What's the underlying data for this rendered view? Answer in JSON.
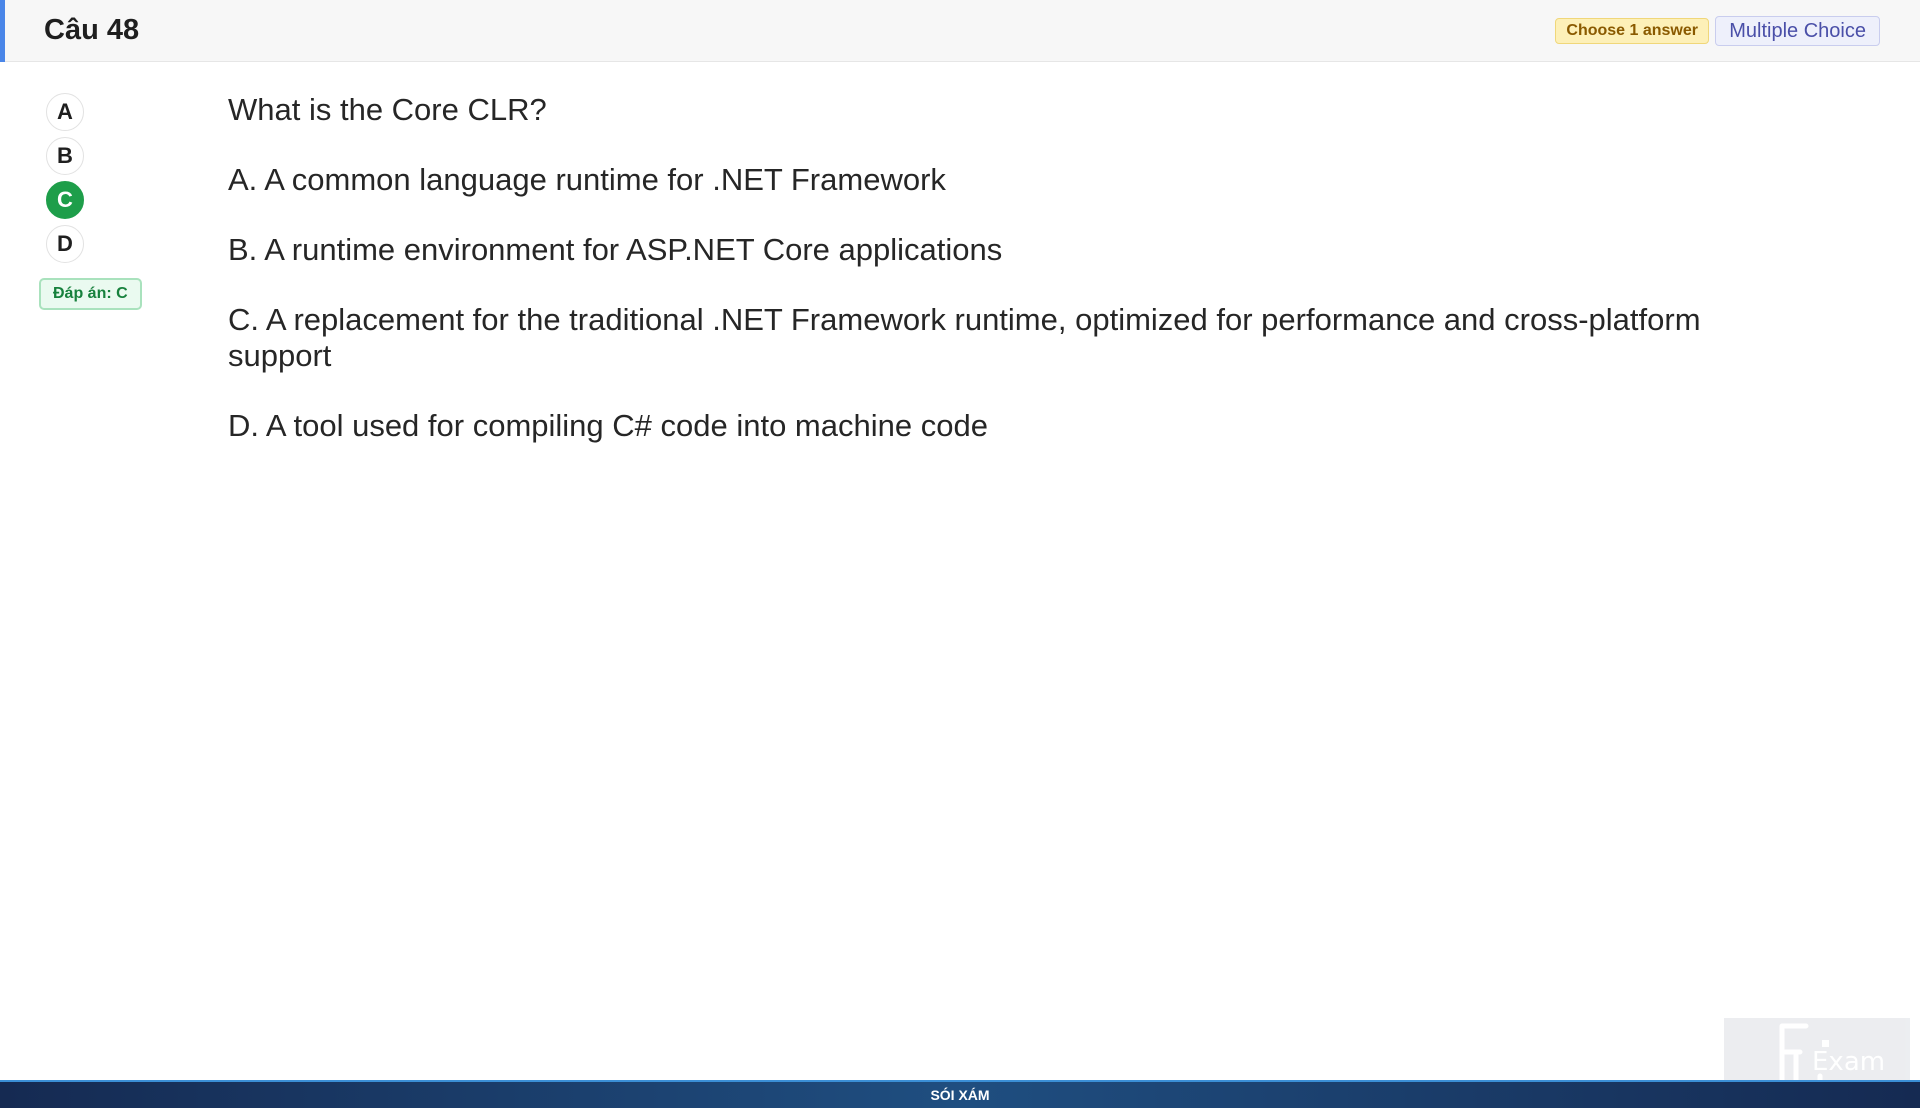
{
  "header": {
    "question_number": "Câu 48",
    "choose_badge": "Choose 1 answer",
    "type_badge": "Multiple Choice"
  },
  "options": {
    "letters": [
      "A",
      "B",
      "C",
      "D"
    ],
    "selected": "C"
  },
  "answer_badge": "Đáp án: C",
  "question": {
    "text": "What is the Core CLR?",
    "choices": [
      "A.  A common language runtime for .NET Framework",
      "B.  A runtime environment for ASP.NET Core applications",
      "C.  A replacement for the traditional .NET Framework runtime, optimized for performance and cross-platform support",
      "D.  A tool used for compiling C# code into machine code"
    ]
  },
  "footer": {
    "text": "SÓI XÁM"
  },
  "watermark": {
    "logo_text": "FU Exam",
    "icon": "fu-exam-logo"
  },
  "colors": {
    "accent": "#4a86e8",
    "selected": "#1e9e4a",
    "footer": "#1f4e80"
  }
}
